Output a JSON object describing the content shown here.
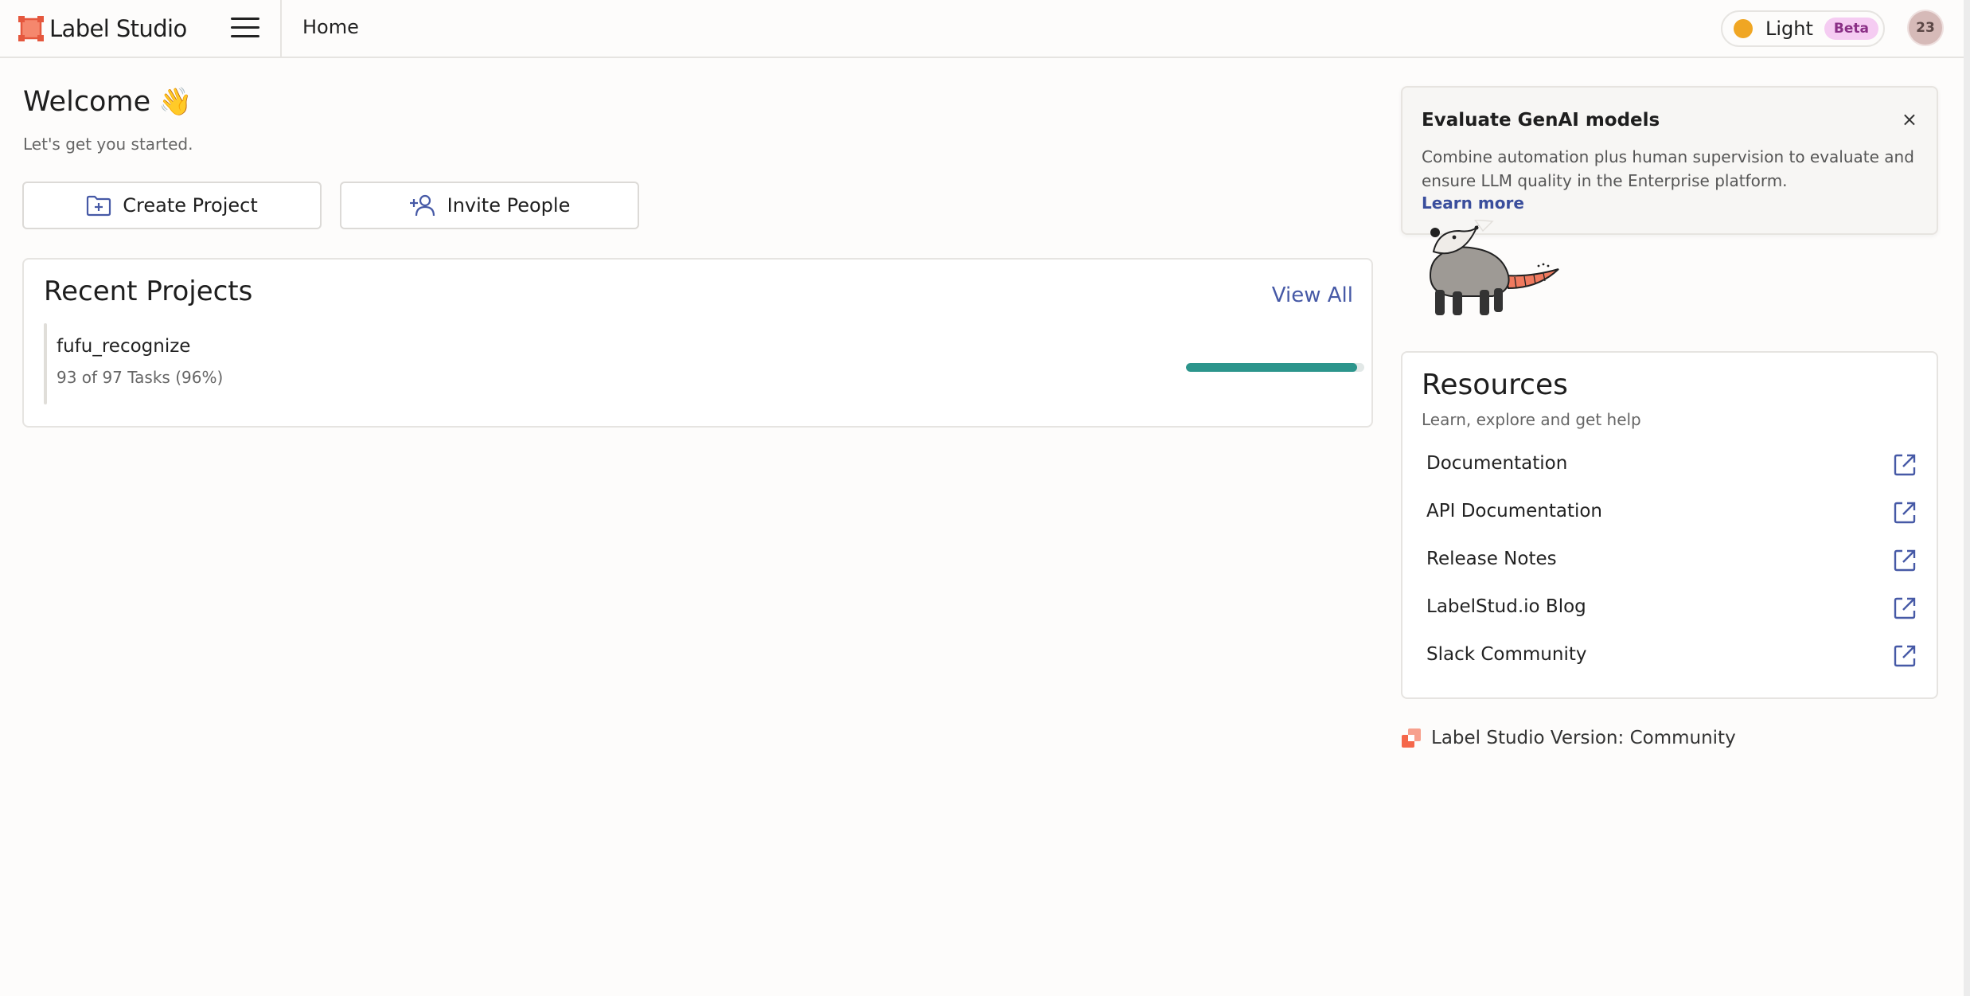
{
  "app": {
    "name": "Label Studio",
    "brand_color": "#f5674a"
  },
  "header": {
    "nav_home": "Home",
    "theme_label": "Light",
    "beta_badge": "Beta",
    "avatar_initials": "23"
  },
  "welcome": {
    "title": "Welcome",
    "wave_emoji": "👋",
    "subtitle": "Let's get you started.",
    "create_project_label": "Create Project",
    "invite_people_label": "Invite People"
  },
  "recent_projects": {
    "title": "Recent Projects",
    "view_all_label": "View All",
    "items": [
      {
        "name": "fufu_recognize",
        "stats": "93 of 97 Tasks (96%)",
        "completed": 93,
        "total": 97,
        "progress_color": "#2c958c"
      }
    ]
  },
  "promo": {
    "title": "Evaluate GenAI models",
    "close_label": "×",
    "body": "Combine automation plus human supervision to evaluate and ensure LLM quality in the Enterprise platform.",
    "link_label": "Learn more"
  },
  "resources": {
    "title": "Resources",
    "subtitle": "Learn, explore and get help",
    "items": [
      {
        "label": "Documentation",
        "icon": "external-link-icon"
      },
      {
        "label": "API Documentation",
        "icon": "external-link-icon"
      },
      {
        "label": "Release Notes",
        "icon": "external-link-icon"
      },
      {
        "label": "LabelStud.io Blog",
        "icon": "external-link-icon"
      },
      {
        "label": "Slack Community",
        "icon": "external-link-icon"
      }
    ]
  },
  "footer": {
    "version_text": "Label Studio Version: Community"
  }
}
